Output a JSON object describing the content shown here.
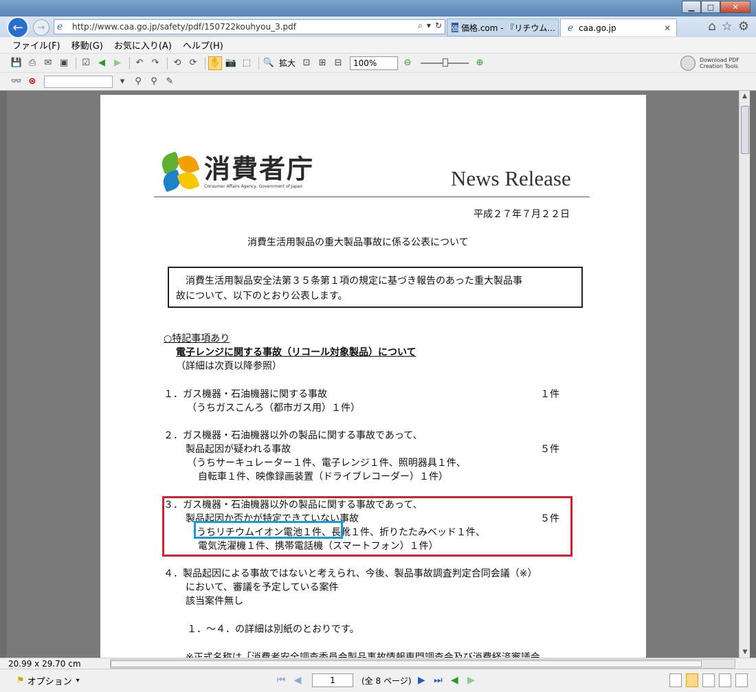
{
  "browser": {
    "address_url": "http://www.caa.go.jp/safety/pdf/150722kouhyou_3.pdf",
    "tabs": [
      {
        "label": "価格.com - 『リチウム...",
        "icon": "kakaku-icon"
      },
      {
        "label": "caa.go.jp",
        "icon": "ie-icon"
      }
    ]
  },
  "menu": [
    "ファイル(F)",
    "移動(G)",
    "お気に入り(A)",
    "ヘルプ(H)"
  ],
  "toolbar": {
    "zoom_in_label": "拡大",
    "zoom_value": "100%",
    "download_line1": "Download PDF",
    "download_line2": "Creation Tools"
  },
  "document": {
    "logo_jp": "消費者庁",
    "logo_en": "Consumer Affairs Agency, Government of Japan",
    "news_release": "News Release",
    "date": "平成２７年７月２２日",
    "title": "消費生活用製品の重大製品事故に係る公表について",
    "notice_line1": "　消費生活用製品安全法第３５条第１項の規定に基づき報告のあった重大製品事",
    "notice_line2": "故について、以下のとおり公表します。",
    "special_head": "○特記事項あり",
    "special_sub": "電子レンジに関する事故（リコール対象製品）について",
    "special_note": "（詳細は次頁以降参照）",
    "item1_line1": "１．ガス機器・石油機器に関する事故",
    "item1_count": "１件",
    "item1_line2": "（うちガスこんろ（都市ガス用）１件）",
    "item2_line1": "２．ガス機器・石油機器以外の製品に関する事故であって、",
    "item2_line2": "製品起因が疑われる事故",
    "item2_count": "５件",
    "item2_line3": "（うちサーキュレーター１件、電子レンジ１件、照明器具１件、",
    "item2_line4": "自転車１件、映像録画装置（ドライブレコーダー）１件）",
    "item3_line1": "３．ガス機器・石油機器以外の製品に関する事故であって、",
    "item3_line2": "製品起因か否かが特定できていない事故",
    "item3_count": "５件",
    "item3_paren": "（",
    "item3_highlight": "うちリチウムイオン電池１件",
    "item3_line3_rest": "、長靴１件、折りたたみベッド１件、",
    "item3_line4": "電気洗濯機１件、携帯電話機（スマートフォン）１件）",
    "item4_line1": "４．製品起因による事故ではないと考えられ、今後、製品事故調査判定合同会議（※）",
    "item4_line2": "において、審議を予定している案件",
    "item4_line3": "該当案件無し",
    "detail_line": "１．～４．の詳細は別紙のとおりです。",
    "footnote_line": "※正式名称は「消費者安全調査委員会製品事故情報専門調査会及び消費経済審議会"
  },
  "status": {
    "page_size": "20.99 x 29.70 cm"
  },
  "bottom": {
    "options_label": "オプション",
    "page_number": "1",
    "page_total": "(全 8 ページ)"
  },
  "colors": {
    "red_highlight": "#d42030",
    "blue_highlight": "#1a9ad6"
  }
}
